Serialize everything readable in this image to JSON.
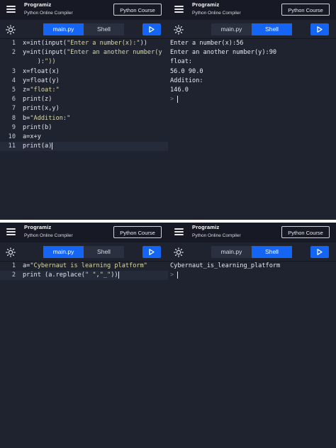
{
  "app": {
    "logo_text": "Programiz",
    "subtitle": "Python Online Compiler",
    "course_button": "Python Course",
    "tab_main": "main.py",
    "tab_shell": "Shell"
  },
  "panel1": {
    "lines": [
      {
        "n": "1",
        "code": "x=int(input(\"Enter a number(x):\"))"
      },
      {
        "n": "2",
        "code": "y=int(input(\"Enter an another number(y"
      },
      {
        "n": "",
        "code": "    ):\"))"
      },
      {
        "n": "3",
        "code": "x=float(x)"
      },
      {
        "n": "4",
        "code": "y=float(y)"
      },
      {
        "n": "5",
        "code": "z=\"float:\""
      },
      {
        "n": "6",
        "code": "print(z)"
      },
      {
        "n": "7",
        "code": "print(x,y)"
      },
      {
        "n": "8",
        "code": "b=\"Addition:\""
      },
      {
        "n": "9",
        "code": "print(b)"
      },
      {
        "n": "10",
        "code": "a=x+y"
      },
      {
        "n": "11",
        "code": "print(a)"
      }
    ]
  },
  "panel2": {
    "output": [
      "Enter a number(x):56",
      "Enter an another number(y):90",
      "float:",
      "56.0 90.0",
      "Addition:",
      "146.0"
    ],
    "prompt": ">"
  },
  "panel3": {
    "lines": [
      {
        "n": "1",
        "code": "a=\"Cybernaut is learning platform\""
      },
      {
        "n": "2",
        "code": "print (a.replace(\" \",\"_\"))"
      }
    ]
  },
  "panel4": {
    "output": [
      "Cybernaut_is_learning_platform"
    ],
    "prompt": ">"
  },
  "colors": {
    "accent": "#1565f5",
    "editor_bg": "#1f2330",
    "header_bg": "#171a24"
  }
}
